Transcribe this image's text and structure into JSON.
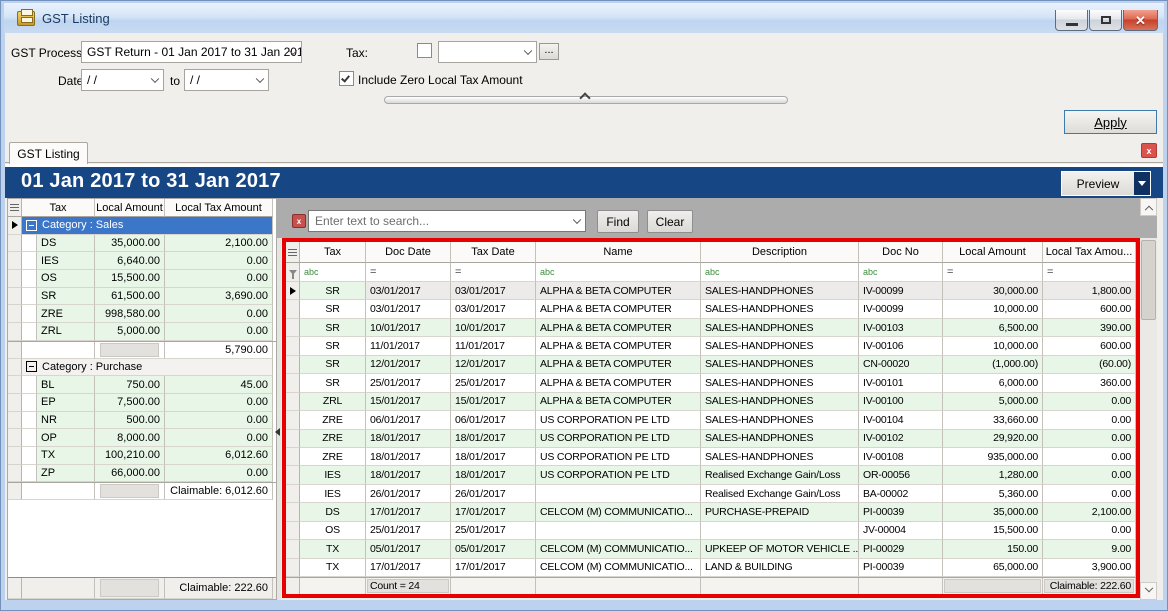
{
  "window": {
    "title": "GST Listing"
  },
  "form": {
    "gst_process_label": "GST Process",
    "gst_process_value": "GST Return - 01 Jan 2017 to 31 Jan 201",
    "tax_label": "Tax:",
    "tax_value": "",
    "ellipsis_label": "...",
    "date_label": "Date",
    "date_from_value": "/ /",
    "to_label": "to",
    "date_to_value": "/ /",
    "include_zero_label": "Include Zero Local Tax Amount",
    "apply_label": "Apply"
  },
  "tab": {
    "label": "GST Listing",
    "close_label": "x"
  },
  "report_header": {
    "title": "01 Jan 2017 to 31 Jan 2017",
    "preview_label": "Preview"
  },
  "summary_panel": {
    "columns": [
      "Tax",
      "Local Amount",
      "Local Tax Amount"
    ],
    "groups": [
      {
        "label": "Category : Sales",
        "selected": true,
        "rows": [
          [
            "DS",
            "35,000.00",
            "2,100.00"
          ],
          [
            "IES",
            "6,640.00",
            "0.00"
          ],
          [
            "OS",
            "15,500.00",
            "0.00"
          ],
          [
            "SR",
            "61,500.00",
            "3,690.00"
          ],
          [
            "ZRE",
            "998,580.00",
            "0.00"
          ],
          [
            "ZRL",
            "5,000.00",
            "0.00"
          ]
        ],
        "summary": "5,790.00"
      },
      {
        "label": "Category : Purchase",
        "selected": false,
        "rows": [
          [
            "BL",
            "750.00",
            "45.00"
          ],
          [
            "EP",
            "7,500.00",
            "0.00"
          ],
          [
            "NR",
            "500.00",
            "0.00"
          ],
          [
            "OP",
            "8,000.00",
            "0.00"
          ],
          [
            "TX",
            "100,210.00",
            "6,012.60"
          ],
          [
            "ZP",
            "66,000.00",
            "0.00"
          ]
        ],
        "summary": "Claimable: 6,012.60"
      }
    ],
    "footer": "Claimable: 222.60"
  },
  "search": {
    "placeholder": "Enter text to search...",
    "find_label": "Find",
    "clear_label": "Clear",
    "close_label": "x"
  },
  "detail_grid": {
    "columns": [
      "Tax",
      "Doc Date",
      "Tax Date",
      "Name",
      "Description",
      "Doc No",
      "Local Amount",
      "Local Tax Amou..."
    ],
    "filter_types": [
      "abc",
      "=",
      "=",
      "abc",
      "abc",
      "abc",
      "=",
      "="
    ],
    "rows": [
      [
        "SR",
        "03/01/2017",
        "03/01/2017",
        "ALPHA & BETA COMPUTER",
        "SALES-HANDPHONES",
        "IV-00099",
        "30,000.00",
        "1,800.00"
      ],
      [
        "SR",
        "03/01/2017",
        "03/01/2017",
        "ALPHA & BETA COMPUTER",
        "SALES-HANDPHONES",
        "IV-00099",
        "10,000.00",
        "600.00"
      ],
      [
        "SR",
        "10/01/2017",
        "10/01/2017",
        "ALPHA & BETA COMPUTER",
        "SALES-HANDPHONES",
        "IV-00103",
        "6,500.00",
        "390.00"
      ],
      [
        "SR",
        "11/01/2017",
        "11/01/2017",
        "ALPHA & BETA COMPUTER",
        "SALES-HANDPHONES",
        "IV-00106",
        "10,000.00",
        "600.00"
      ],
      [
        "SR",
        "12/01/2017",
        "12/01/2017",
        "ALPHA & BETA COMPUTER",
        "SALES-HANDPHONES",
        "CN-00020",
        "(1,000.00)",
        "(60.00)"
      ],
      [
        "SR",
        "25/01/2017",
        "25/01/2017",
        "ALPHA & BETA COMPUTER",
        "SALES-HANDPHONES",
        "IV-00101",
        "6,000.00",
        "360.00"
      ],
      [
        "ZRL",
        "15/01/2017",
        "15/01/2017",
        "ALPHA & BETA COMPUTER",
        "SALES-HANDPHONES",
        "IV-00100",
        "5,000.00",
        "0.00"
      ],
      [
        "ZRE",
        "06/01/2017",
        "06/01/2017",
        "US CORPORATION PE LTD",
        "SALES-HANDPHONES",
        "IV-00104",
        "33,660.00",
        "0.00"
      ],
      [
        "ZRE",
        "18/01/2017",
        "18/01/2017",
        "US CORPORATION PE LTD",
        "SALES-HANDPHONES",
        "IV-00102",
        "29,920.00",
        "0.00"
      ],
      [
        "ZRE",
        "18/01/2017",
        "18/01/2017",
        "US CORPORATION PE LTD",
        "SALES-HANDPHONES",
        "IV-00108",
        "935,000.00",
        "0.00"
      ],
      [
        "IES",
        "18/01/2017",
        "18/01/2017",
        "US CORPORATION PE LTD",
        "Realised Exchange Gain/Loss",
        "OR-00056",
        "1,280.00",
        "0.00"
      ],
      [
        "IES",
        "26/01/2017",
        "26/01/2017",
        "",
        "Realised Exchange Gain/Loss",
        "BA-00002",
        "5,360.00",
        "0.00"
      ],
      [
        "DS",
        "17/01/2017",
        "17/01/2017",
        "CELCOM (M) COMMUNICATIO...",
        "PURCHASE-PREPAID",
        "PI-00039",
        "35,000.00",
        "2,100.00"
      ],
      [
        "OS",
        "25/01/2017",
        "25/01/2017",
        "",
        "",
        "JV-00004",
        "15,500.00",
        "0.00"
      ],
      [
        "TX",
        "05/01/2017",
        "05/01/2017",
        "CELCOM (M) COMMUNICATIO...",
        "UPKEEP OF MOTOR VEHICLE ...",
        "PI-00029",
        "150.00",
        "9.00"
      ],
      [
        "TX",
        "17/01/2017",
        "17/01/2017",
        "CELCOM (M) COMMUNICATIO...",
        "LAND & BUILDING",
        "PI-00039",
        "65,000.00",
        "3,900.00"
      ]
    ],
    "footer": {
      "count": "Count = 24",
      "claimable": "Claimable: 222.60"
    }
  }
}
